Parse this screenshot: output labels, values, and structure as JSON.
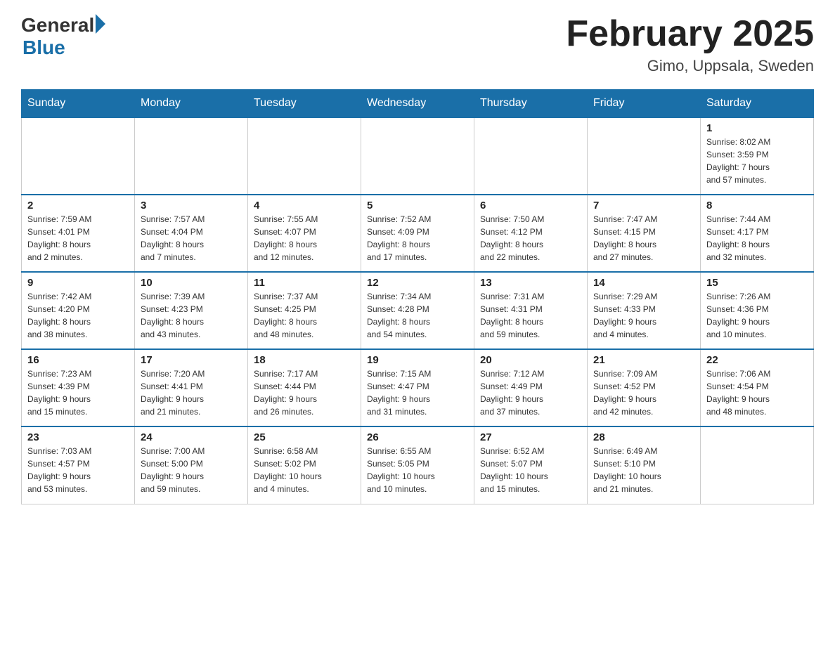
{
  "header": {
    "logo_general": "General",
    "logo_blue": "Blue",
    "month_title": "February 2025",
    "location": "Gimo, Uppsala, Sweden"
  },
  "days_of_week": [
    "Sunday",
    "Monday",
    "Tuesday",
    "Wednesday",
    "Thursday",
    "Friday",
    "Saturday"
  ],
  "weeks": [
    [
      {
        "day": "",
        "info": ""
      },
      {
        "day": "",
        "info": ""
      },
      {
        "day": "",
        "info": ""
      },
      {
        "day": "",
        "info": ""
      },
      {
        "day": "",
        "info": ""
      },
      {
        "day": "",
        "info": ""
      },
      {
        "day": "1",
        "info": "Sunrise: 8:02 AM\nSunset: 3:59 PM\nDaylight: 7 hours\nand 57 minutes."
      }
    ],
    [
      {
        "day": "2",
        "info": "Sunrise: 7:59 AM\nSunset: 4:01 PM\nDaylight: 8 hours\nand 2 minutes."
      },
      {
        "day": "3",
        "info": "Sunrise: 7:57 AM\nSunset: 4:04 PM\nDaylight: 8 hours\nand 7 minutes."
      },
      {
        "day": "4",
        "info": "Sunrise: 7:55 AM\nSunset: 4:07 PM\nDaylight: 8 hours\nand 12 minutes."
      },
      {
        "day": "5",
        "info": "Sunrise: 7:52 AM\nSunset: 4:09 PM\nDaylight: 8 hours\nand 17 minutes."
      },
      {
        "day": "6",
        "info": "Sunrise: 7:50 AM\nSunset: 4:12 PM\nDaylight: 8 hours\nand 22 minutes."
      },
      {
        "day": "7",
        "info": "Sunrise: 7:47 AM\nSunset: 4:15 PM\nDaylight: 8 hours\nand 27 minutes."
      },
      {
        "day": "8",
        "info": "Sunrise: 7:44 AM\nSunset: 4:17 PM\nDaylight: 8 hours\nand 32 minutes."
      }
    ],
    [
      {
        "day": "9",
        "info": "Sunrise: 7:42 AM\nSunset: 4:20 PM\nDaylight: 8 hours\nand 38 minutes."
      },
      {
        "day": "10",
        "info": "Sunrise: 7:39 AM\nSunset: 4:23 PM\nDaylight: 8 hours\nand 43 minutes."
      },
      {
        "day": "11",
        "info": "Sunrise: 7:37 AM\nSunset: 4:25 PM\nDaylight: 8 hours\nand 48 minutes."
      },
      {
        "day": "12",
        "info": "Sunrise: 7:34 AM\nSunset: 4:28 PM\nDaylight: 8 hours\nand 54 minutes."
      },
      {
        "day": "13",
        "info": "Sunrise: 7:31 AM\nSunset: 4:31 PM\nDaylight: 8 hours\nand 59 minutes."
      },
      {
        "day": "14",
        "info": "Sunrise: 7:29 AM\nSunset: 4:33 PM\nDaylight: 9 hours\nand 4 minutes."
      },
      {
        "day": "15",
        "info": "Sunrise: 7:26 AM\nSunset: 4:36 PM\nDaylight: 9 hours\nand 10 minutes."
      }
    ],
    [
      {
        "day": "16",
        "info": "Sunrise: 7:23 AM\nSunset: 4:39 PM\nDaylight: 9 hours\nand 15 minutes."
      },
      {
        "day": "17",
        "info": "Sunrise: 7:20 AM\nSunset: 4:41 PM\nDaylight: 9 hours\nand 21 minutes."
      },
      {
        "day": "18",
        "info": "Sunrise: 7:17 AM\nSunset: 4:44 PM\nDaylight: 9 hours\nand 26 minutes."
      },
      {
        "day": "19",
        "info": "Sunrise: 7:15 AM\nSunset: 4:47 PM\nDaylight: 9 hours\nand 31 minutes."
      },
      {
        "day": "20",
        "info": "Sunrise: 7:12 AM\nSunset: 4:49 PM\nDaylight: 9 hours\nand 37 minutes."
      },
      {
        "day": "21",
        "info": "Sunrise: 7:09 AM\nSunset: 4:52 PM\nDaylight: 9 hours\nand 42 minutes."
      },
      {
        "day": "22",
        "info": "Sunrise: 7:06 AM\nSunset: 4:54 PM\nDaylight: 9 hours\nand 48 minutes."
      }
    ],
    [
      {
        "day": "23",
        "info": "Sunrise: 7:03 AM\nSunset: 4:57 PM\nDaylight: 9 hours\nand 53 minutes."
      },
      {
        "day": "24",
        "info": "Sunrise: 7:00 AM\nSunset: 5:00 PM\nDaylight: 9 hours\nand 59 minutes."
      },
      {
        "day": "25",
        "info": "Sunrise: 6:58 AM\nSunset: 5:02 PM\nDaylight: 10 hours\nand 4 minutes."
      },
      {
        "day": "26",
        "info": "Sunrise: 6:55 AM\nSunset: 5:05 PM\nDaylight: 10 hours\nand 10 minutes."
      },
      {
        "day": "27",
        "info": "Sunrise: 6:52 AM\nSunset: 5:07 PM\nDaylight: 10 hours\nand 15 minutes."
      },
      {
        "day": "28",
        "info": "Sunrise: 6:49 AM\nSunset: 5:10 PM\nDaylight: 10 hours\nand 21 minutes."
      },
      {
        "day": "",
        "info": ""
      }
    ]
  ]
}
